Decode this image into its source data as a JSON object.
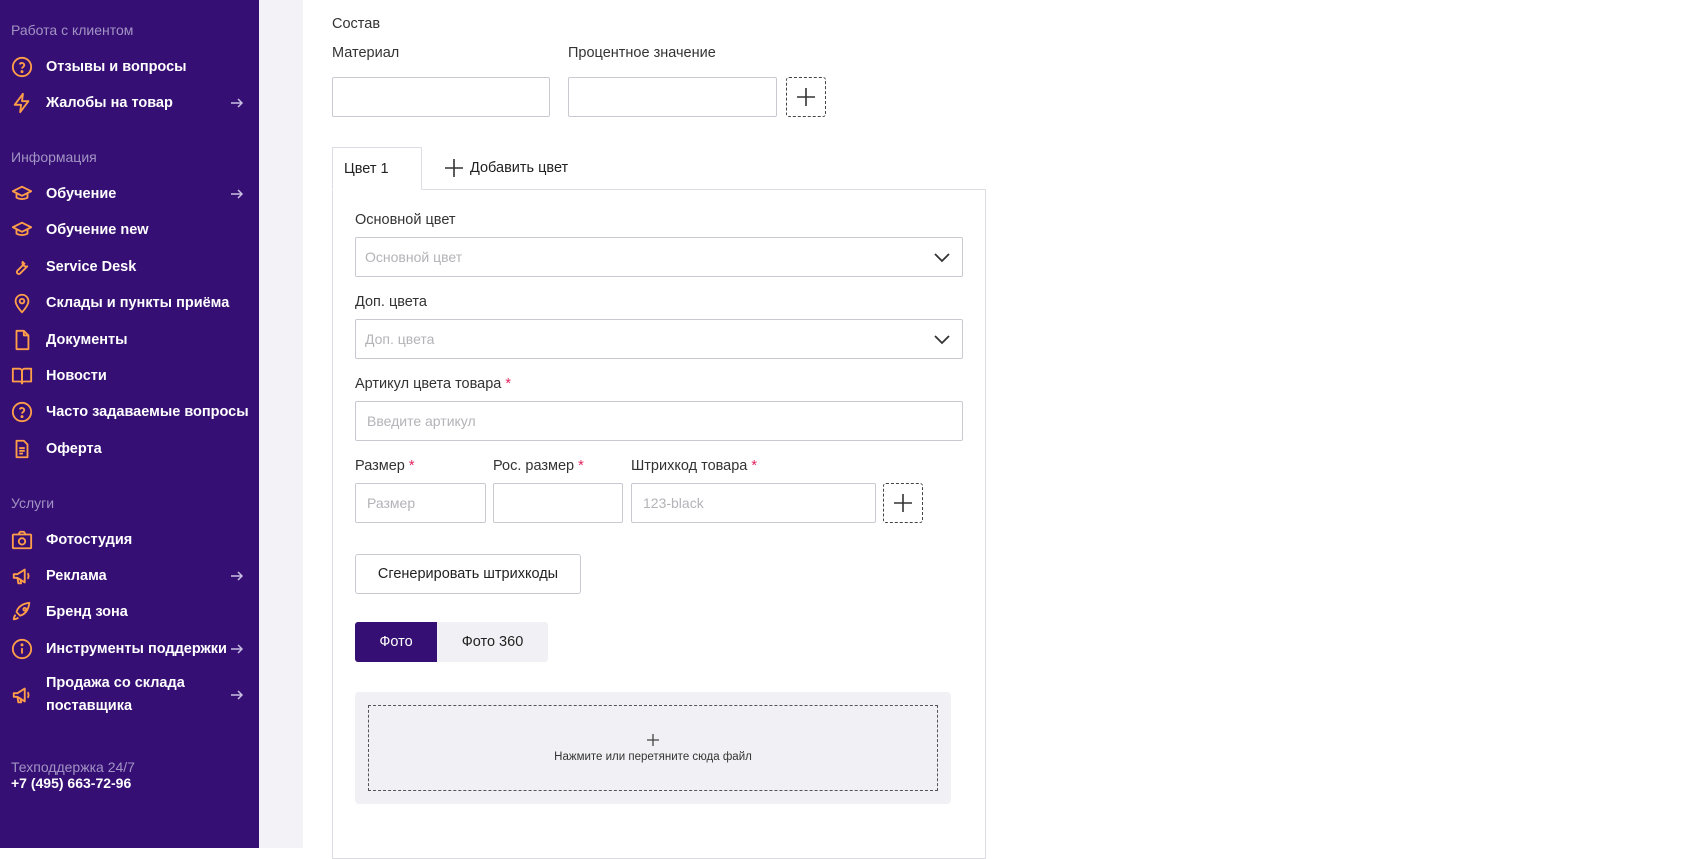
{
  "sidebar": {
    "sections": [
      {
        "title": "Работа с клиентом"
      },
      {
        "title": "Информация"
      },
      {
        "title": "Услуги"
      }
    ],
    "items": [
      {
        "label": "Отзывы и вопросы",
        "icon": "question-circle-icon"
      },
      {
        "label": "Жалобы на товар",
        "icon": "lightning-icon",
        "has_arrow": true
      },
      {
        "label": "Обучение",
        "icon": "graduation-cap-icon",
        "has_arrow": true
      },
      {
        "label": "Обучение new",
        "icon": "graduation-cap-icon"
      },
      {
        "label": "Service Desk",
        "icon": "wrench-icon"
      },
      {
        "label": "Склады и пункты приёма",
        "icon": "map-pin-icon"
      },
      {
        "label": "Документы",
        "icon": "document-icon"
      },
      {
        "label": "Новости",
        "icon": "book-icon"
      },
      {
        "label": "Часто задаваемые вопросы",
        "icon": "question-circle-icon"
      },
      {
        "label": "Оферта",
        "icon": "file-text-icon"
      },
      {
        "label": "Фотостудия",
        "icon": "camera-icon"
      },
      {
        "label": "Реклама",
        "icon": "megaphone-icon",
        "has_arrow": true
      },
      {
        "label": "Бренд зона",
        "icon": "rocket-icon"
      },
      {
        "label": "Инструменты поддержки",
        "icon": "info-circle-icon",
        "has_arrow": true
      },
      {
        "label": "Продажа со склада поставщика",
        "icon": "megaphone-icon",
        "has_arrow": true
      }
    ],
    "support": {
      "label": "Техподдержка 24/7",
      "phone": "+7 (495) 663-72-96"
    },
    "accent_color": "#360f74",
    "icon_color": "#ff9e48"
  },
  "composition": {
    "title": "Состав",
    "material_label": "Материал",
    "material_value": "",
    "percent_label": "Процентное значение",
    "percent_value": ""
  },
  "color_tabs": {
    "active_tab": "Цвет 1",
    "add_label": "Добавить цвет"
  },
  "color_form": {
    "main_color_label": "Основной цвет",
    "main_color_placeholder": "Основной цвет",
    "extra_colors_label": "Доп. цвета",
    "extra_colors_placeholder": "Доп. цвета",
    "article_label": "Артикул цвета товара",
    "article_placeholder": "Введите артикул",
    "size_label": "Размер",
    "size_placeholder": "Размер",
    "ru_size_label": "Рос. размер",
    "ru_size_placeholder": "",
    "barcode_label": "Штрихкод товара",
    "barcode_placeholder": "123-black",
    "required_mark": "*",
    "generate_button": "Сгенерировать штрихкоды"
  },
  "media": {
    "tabs": [
      "Фото",
      "Фото 360"
    ],
    "active_tab": "Фото",
    "drop_text": "Нажмите или перетяните сюда файл"
  }
}
